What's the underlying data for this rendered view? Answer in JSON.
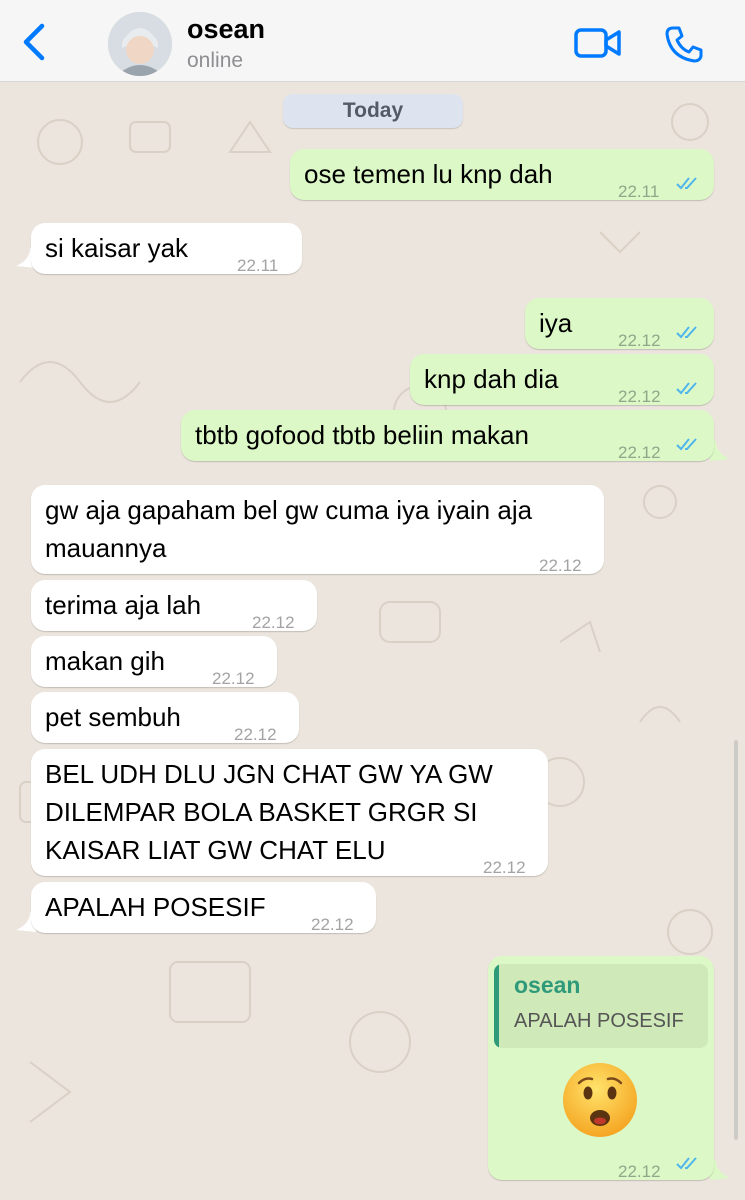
{
  "header": {
    "contact_name": "osean",
    "status": "online",
    "icons": [
      "back-chevron-icon",
      "video-call-icon",
      "phone-icon"
    ]
  },
  "date_chip": "Today",
  "messages": [
    {
      "dir": "out",
      "text": "ose temen lu knp dah",
      "time": "22.11"
    },
    {
      "dir": "in",
      "text": "si kaisar yak",
      "time": "22.11"
    },
    {
      "dir": "out",
      "text": "iya",
      "time": "22.12"
    },
    {
      "dir": "out",
      "text": "knp dah dia",
      "time": "22.12"
    },
    {
      "dir": "out",
      "text": "tbtb gofood tbtb beliin makan",
      "time": "22.12"
    },
    {
      "dir": "in",
      "text": "gw aja gapaham bel gw cuma iya iyain aja\nmauannya",
      "time": "22.12"
    },
    {
      "dir": "in",
      "text": "terima aja lah",
      "time": "22.12"
    },
    {
      "dir": "in",
      "text": "makan gih",
      "time": "22.12"
    },
    {
      "dir": "in",
      "text": "pet sembuh",
      "time": "22.12"
    },
    {
      "dir": "in",
      "text": "BEL UDH DLU JGN CHAT GW YA GW\nDILEMPAR BOLA BASKET GRGR SI\nKAISAR LIAT GW CHAT ELU",
      "time": "22.12"
    },
    {
      "dir": "in",
      "text": "APALAH POSESIF",
      "time": "22.12"
    },
    {
      "dir": "out",
      "reply_to": {
        "name": "osean",
        "text": "APALAH POSESIF"
      },
      "emoji": "frowning-face-with-open-mouth",
      "time": "22.12"
    }
  ],
  "colors": {
    "accent": "#007aff",
    "outgoing_bubble": "#dcf8c6",
    "incoming_bubble": "#ffffff",
    "background": "#ece5dd",
    "read_ticks": "#4fb6ec",
    "quote_name": "#2f9a7a"
  }
}
